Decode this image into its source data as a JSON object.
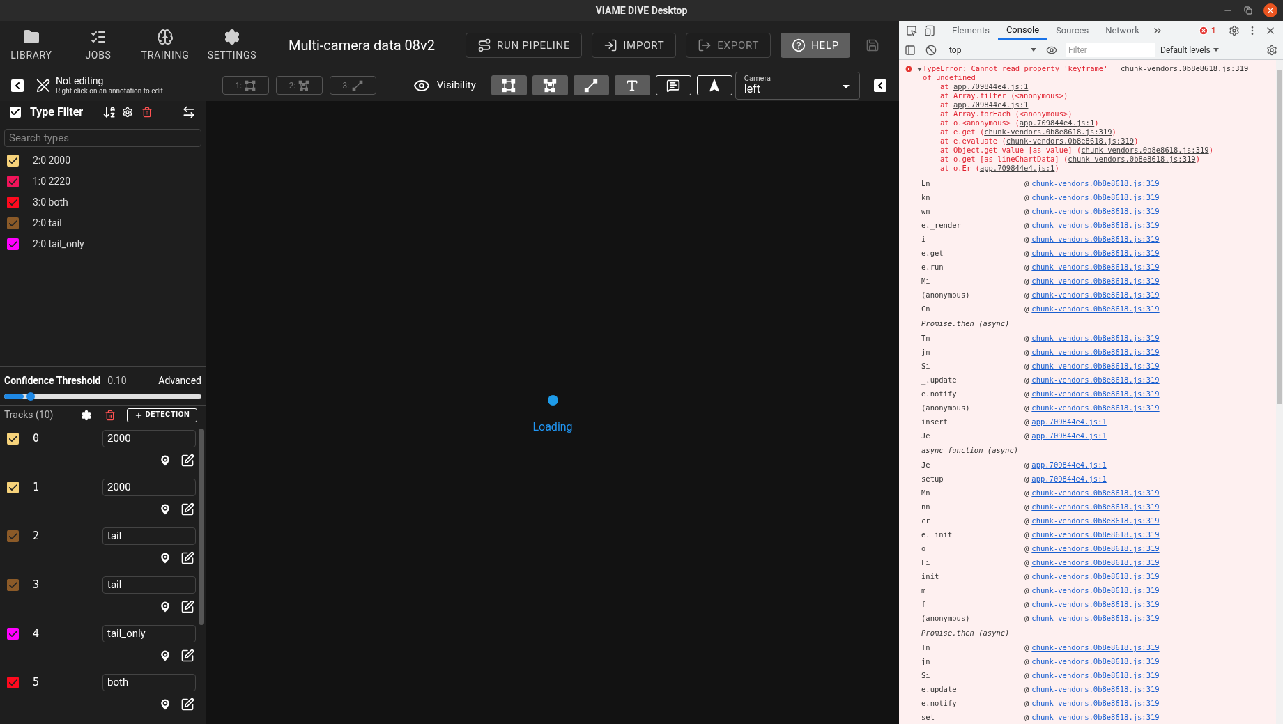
{
  "window": {
    "title": "VIAME DIVE Desktop"
  },
  "nav": [
    {
      "label": "LIBRARY",
      "kind": "library"
    },
    {
      "label": "JOBS",
      "kind": "jobs"
    },
    {
      "label": "TRAINING",
      "kind": "training"
    },
    {
      "label": "SETTINGS",
      "kind": "settings"
    }
  ],
  "dataset_title": "Multi-camera data 08v2",
  "actions": [
    {
      "label": "RUN PIPELINE",
      "kind": "pipeline",
      "disabled": false,
      "primary": false
    },
    {
      "label": "IMPORT",
      "kind": "import",
      "disabled": false,
      "primary": false
    },
    {
      "label": "EXPORT",
      "kind": "export",
      "disabled": true,
      "primary": false
    },
    {
      "label": "HELP",
      "kind": "help",
      "disabled": false,
      "primary": true
    }
  ],
  "save_button": {
    "disabled": true
  },
  "edit_status": {
    "title": "Not editing",
    "hint": "Right click on an annotation to edit"
  },
  "modes": [
    {
      "label": "1:",
      "kind": "box",
      "disabled": true
    },
    {
      "label": "2:",
      "kind": "polygon",
      "disabled": true
    },
    {
      "label": "3:",
      "kind": "line",
      "disabled": true
    }
  ],
  "visibility": {
    "label": "Visibility",
    "toggles": [
      {
        "kind": "box",
        "on": true
      },
      {
        "kind": "polygon",
        "on": true
      },
      {
        "kind": "line",
        "on": true
      },
      {
        "kind": "text",
        "on": true
      },
      {
        "kind": "comment",
        "on": false
      },
      {
        "kind": "arrow",
        "on": false
      }
    ]
  },
  "camera": {
    "label": "Camera",
    "value": "left"
  },
  "type_filter": {
    "title": "Type Filter",
    "checked": true,
    "search_placeholder": "Search types",
    "types": [
      {
        "label": "2:0 2000",
        "color": "#f6d27a",
        "checked": true
      },
      {
        "label": "1:0 2220",
        "color": "#f0145a",
        "checked": true
      },
      {
        "label": "3:0 both",
        "color": "#ff0a1e",
        "checked": true
      },
      {
        "label": "2:0 tail",
        "color": "#8b5a28",
        "checked": true
      },
      {
        "label": "2:0 tail_only",
        "color": "#ff00ff",
        "checked": true
      }
    ]
  },
  "confidence": {
    "label": "Confidence Threshold",
    "value": "0.10",
    "level": 0.1,
    "link": "Advanced"
  },
  "tracks": {
    "title": "Tracks (10)",
    "add_label": "DETECTION",
    "items": [
      {
        "id": "0",
        "type": "2000",
        "color": "#f6d27a",
        "checked": true
      },
      {
        "id": "1",
        "type": "2000",
        "color": "#f6d27a",
        "checked": true
      },
      {
        "id": "2",
        "type": "tail",
        "color": "#8b5a28",
        "checked": true
      },
      {
        "id": "3",
        "type": "tail",
        "color": "#8b5a28",
        "checked": true
      },
      {
        "id": "4",
        "type": "tail_only",
        "color": "#ff00ff",
        "checked": true
      },
      {
        "id": "5",
        "type": "both",
        "color": "#ff0a1e",
        "checked": true
      }
    ]
  },
  "viewer": {
    "status": "Loading"
  },
  "devtools": {
    "tabs": [
      {
        "label": "Elements",
        "selected": false
      },
      {
        "label": "Console",
        "selected": true
      },
      {
        "label": "Sources",
        "selected": false
      },
      {
        "label": "Network",
        "selected": false
      }
    ],
    "error_count": "1",
    "context": "top",
    "filter_placeholder": "Filter",
    "levels": "Default levels",
    "error": {
      "message": "TypeError: Cannot read property 'keyframe' of undefined",
      "source": "chunk-vendors.0b8e8618.js:319",
      "expanded": true,
      "stack": [
        {
          "before": "at ",
          "link": "app.709844e4.js:1"
        },
        {
          "before": "at Array.filter (<anonymous>)"
        },
        {
          "before": "at ",
          "link": "app.709844e4.js:1"
        },
        {
          "before": "at Array.forEach (<anonymous>)"
        },
        {
          "before": "at o.<anonymous> (",
          "link": "app.709844e4.js:1",
          "after": ")"
        },
        {
          "before": "at e.get (",
          "link": "chunk-vendors.0b8e8618.js:319",
          "after": ")"
        },
        {
          "before": "at e.evaluate (",
          "link": "chunk-vendors.0b8e8618.js:319",
          "after": ")"
        },
        {
          "before": "at Object.get value [as value] (",
          "link": "chunk-vendors.0b8e8618.js:319",
          "after": ")"
        },
        {
          "before": "at o.get [as lineChartData] (",
          "link": "chunk-vendors.0b8e8618.js:319",
          "after": ")"
        },
        {
          "before": "at o.Er (",
          "link": "app.709844e4.js:1",
          "after": ")"
        }
      ]
    },
    "frames": [
      {
        "kind": "frame",
        "name": "Ln",
        "at": "@",
        "link": "chunk-vendors.0b8e8618.js:319"
      },
      {
        "kind": "frame",
        "name": "kn",
        "at": "@",
        "link": "chunk-vendors.0b8e8618.js:319"
      },
      {
        "kind": "frame",
        "name": "wn",
        "at": "@",
        "link": "chunk-vendors.0b8e8618.js:319"
      },
      {
        "kind": "frame",
        "name": "e._render",
        "at": "@",
        "link": "chunk-vendors.0b8e8618.js:319"
      },
      {
        "kind": "frame",
        "name": "i",
        "at": "@",
        "link": "chunk-vendors.0b8e8618.js:319"
      },
      {
        "kind": "frame",
        "name": "e.get",
        "at": "@",
        "link": "chunk-vendors.0b8e8618.js:319"
      },
      {
        "kind": "frame",
        "name": "e.run",
        "at": "@",
        "link": "chunk-vendors.0b8e8618.js:319"
      },
      {
        "kind": "frame",
        "name": "Mi",
        "at": "@",
        "link": "chunk-vendors.0b8e8618.js:319"
      },
      {
        "kind": "frame",
        "name": "(anonymous)",
        "at": "@",
        "link": "chunk-vendors.0b8e8618.js:319"
      },
      {
        "kind": "frame",
        "name": "Cn",
        "at": "@",
        "link": "chunk-vendors.0b8e8618.js:319"
      },
      {
        "kind": "async",
        "name": "Promise.then (async)"
      },
      {
        "kind": "frame",
        "name": "Tn",
        "at": "@",
        "link": "chunk-vendors.0b8e8618.js:319"
      },
      {
        "kind": "frame",
        "name": "jn",
        "at": "@",
        "link": "chunk-vendors.0b8e8618.js:319"
      },
      {
        "kind": "frame",
        "name": "Si",
        "at": "@",
        "link": "chunk-vendors.0b8e8618.js:319"
      },
      {
        "kind": "frame",
        "name": "_.update",
        "at": "@",
        "link": "chunk-vendors.0b8e8618.js:319"
      },
      {
        "kind": "frame",
        "name": "e.notify",
        "at": "@",
        "link": "chunk-vendors.0b8e8618.js:319"
      },
      {
        "kind": "frame",
        "name": "(anonymous)",
        "at": "@",
        "link": "chunk-vendors.0b8e8618.js:319"
      },
      {
        "kind": "frame",
        "name": "insert",
        "at": "@",
        "link": "app.709844e4.js:1"
      },
      {
        "kind": "frame",
        "name": "Je",
        "at": "@",
        "link": "app.709844e4.js:1"
      },
      {
        "kind": "async",
        "name": "async function (async)"
      },
      {
        "kind": "frame",
        "name": "Je",
        "at": "@",
        "link": "app.709844e4.js:1"
      },
      {
        "kind": "frame",
        "name": "setup",
        "at": "@",
        "link": "app.709844e4.js:1"
      },
      {
        "kind": "frame",
        "name": "Mn",
        "at": "@",
        "link": "chunk-vendors.0b8e8618.js:319"
      },
      {
        "kind": "frame",
        "name": "nn",
        "at": "@",
        "link": "chunk-vendors.0b8e8618.js:319"
      },
      {
        "kind": "frame",
        "name": "cr",
        "at": "@",
        "link": "chunk-vendors.0b8e8618.js:319"
      },
      {
        "kind": "frame",
        "name": "e._init",
        "at": "@",
        "link": "chunk-vendors.0b8e8618.js:319"
      },
      {
        "kind": "frame",
        "name": "o",
        "at": "@",
        "link": "chunk-vendors.0b8e8618.js:319"
      },
      {
        "kind": "frame",
        "name": "Fi",
        "at": "@",
        "link": "chunk-vendors.0b8e8618.js:319"
      },
      {
        "kind": "frame",
        "name": "init",
        "at": "@",
        "link": "chunk-vendors.0b8e8618.js:319"
      },
      {
        "kind": "frame",
        "name": "m",
        "at": "@",
        "link": "chunk-vendors.0b8e8618.js:319"
      },
      {
        "kind": "frame",
        "name": "f",
        "at": "@",
        "link": "chunk-vendors.0b8e8618.js:319"
      },
      {
        "kind": "frame",
        "name": "(anonymous)",
        "at": "@",
        "link": "chunk-vendors.0b8e8618.js:319"
      },
      {
        "kind": "async",
        "name": "Promise.then (async)"
      },
      {
        "kind": "frame",
        "name": "Tn",
        "at": "@",
        "link": "chunk-vendors.0b8e8618.js:319"
      },
      {
        "kind": "frame",
        "name": "jn",
        "at": "@",
        "link": "chunk-vendors.0b8e8618.js:319"
      },
      {
        "kind": "frame",
        "name": "Si",
        "at": "@",
        "link": "chunk-vendors.0b8e8618.js:319"
      },
      {
        "kind": "frame",
        "name": "e.update",
        "at": "@",
        "link": "chunk-vendors.0b8e8618.js:319"
      },
      {
        "kind": "frame",
        "name": "e.notify",
        "at": "@",
        "link": "chunk-vendors.0b8e8618.js:319"
      },
      {
        "kind": "frame",
        "name": "set",
        "at": "@",
        "link": "chunk-vendors.0b8e8618.js:319"
      }
    ]
  }
}
